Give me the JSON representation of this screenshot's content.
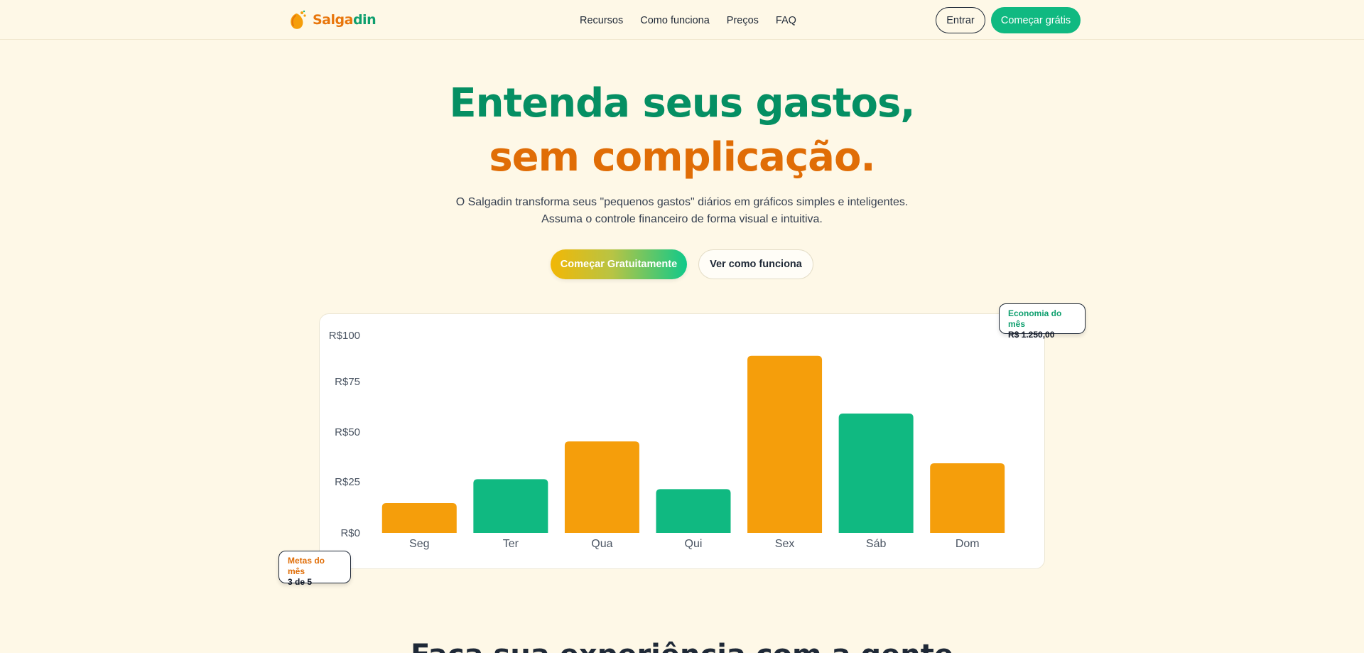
{
  "brand": {
    "name_part1": "Salga",
    "name_part2": "din",
    "primary_color": "#0e9f6e",
    "accent_color": "#e8760c"
  },
  "nav": {
    "links": [
      "Recursos",
      "Como funciona",
      "Preços",
      "FAQ"
    ],
    "login_label": "Entrar",
    "signup_label": "Começar grátis"
  },
  "hero": {
    "title_line1": "Entenda seus gastos,",
    "title_line2": "sem complicação.",
    "subtitle_line1": "O Salgadin transforma seus \"pequenos gastos\" diários em gráficos simples e inteligentes.",
    "subtitle_line2": "Assuma o controle financeiro de forma visual e intuitiva.",
    "primary_cta": "Começar Gratuitamente",
    "secondary_cta": "Ver como funciona"
  },
  "badges": {
    "economy": {
      "title": "Economia do mês",
      "value": "R$ 1.250,00"
    },
    "goals": {
      "title": "Metas do mês",
      "value": "3 de 5"
    }
  },
  "chart_data": {
    "type": "bar",
    "categories": [
      "Seg",
      "Ter",
      "Qua",
      "Qui",
      "Sex",
      "Sáb",
      "Dom"
    ],
    "values": [
      15,
      27,
      46,
      22,
      89,
      60,
      35
    ],
    "bar_colors": [
      "#f59e0b",
      "#10b981",
      "#f59e0b",
      "#10b981",
      "#f59e0b",
      "#10b981",
      "#f59e0b"
    ],
    "y_ticks": [
      "R$0",
      "R$25",
      "R$50",
      "R$75",
      "R$100"
    ],
    "ylim": [
      0,
      100
    ],
    "grid": false,
    "title": "",
    "xlabel": "",
    "ylabel": ""
  },
  "next_section": {
    "title": "Faça sua experiência com a gente"
  }
}
